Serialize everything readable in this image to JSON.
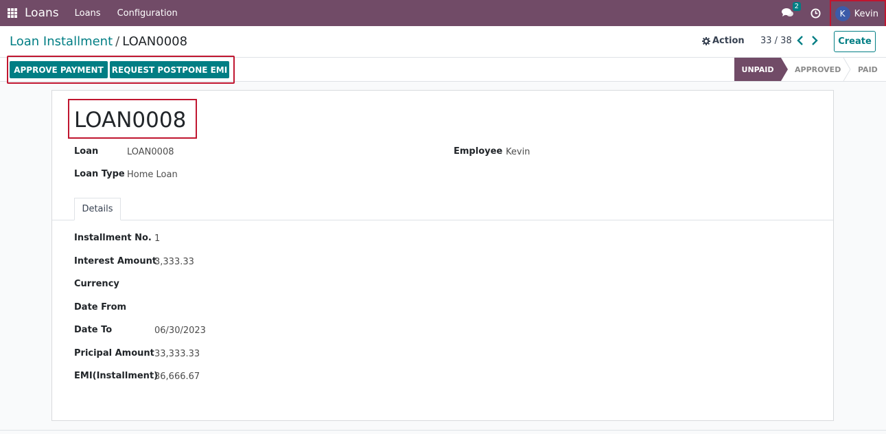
{
  "navbar": {
    "brand": "Loans",
    "menu": [
      "Loans",
      "Configuration"
    ],
    "chat_count": "2",
    "user": {
      "initial": "K",
      "name": "Kevin"
    }
  },
  "control_panel": {
    "breadcrumb_parent": "Loan Installment",
    "breadcrumb_separator": "/",
    "breadcrumb_current": "LOAN0008",
    "action_label": "Action",
    "pager": "33 / 38",
    "create_label": "Create"
  },
  "statusbar": {
    "buttons": [
      "APPROVE PAYMENT",
      "REQUEST POSTPONE EMI"
    ],
    "stages": [
      "UNPAID",
      "APPROVED",
      "PAID"
    ],
    "active_stage": "UNPAID"
  },
  "record": {
    "title": "LOAN0008",
    "loan_label": "Loan",
    "loan_value": "LOAN0008",
    "loan_type_label": "Loan Type",
    "loan_type_value": "Home Loan",
    "employee_label": "Employee",
    "employee_value": "Kevin"
  },
  "tabs": [
    "Details"
  ],
  "details": [
    {
      "label": "Installment No.",
      "value": "1"
    },
    {
      "label": "Interest Amount",
      "value": "3,333.33"
    },
    {
      "label": "Currency",
      "value": ""
    },
    {
      "label": "Date From",
      "value": ""
    },
    {
      "label": "Date To",
      "value": "06/30/2023"
    },
    {
      "label": "Pricipal Amount",
      "value": "33,333.33"
    },
    {
      "label": "EMI(Installment)",
      "value": "36,666.67"
    }
  ],
  "colors": {
    "brand": "#714b67",
    "primary": "#017e84",
    "highlight_frame": "#c0152f"
  }
}
